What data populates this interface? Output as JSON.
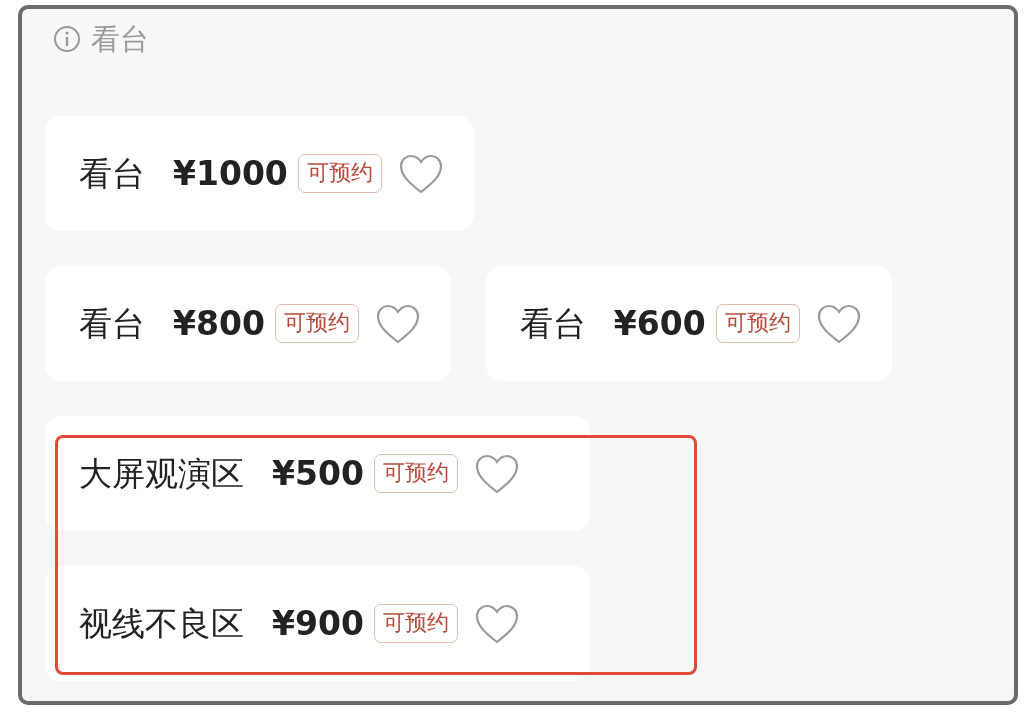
{
  "section": {
    "title": "看台"
  },
  "rows": [
    {
      "highlighted": false,
      "tickets": [
        {
          "name": "看台",
          "price": "¥1000",
          "tag": "可预约",
          "favorited": false
        }
      ]
    },
    {
      "highlighted": false,
      "tickets": [
        {
          "name": "看台",
          "price": "¥800",
          "tag": "可预约",
          "favorited": false
        },
        {
          "name": "看台",
          "price": "¥600",
          "tag": "可预约",
          "favorited": false
        }
      ]
    },
    {
      "highlighted": true,
      "tickets": [
        {
          "name": "大屏观演区",
          "price": "¥500",
          "tag": "可预约",
          "favorited": false
        }
      ]
    },
    {
      "highlighted": true,
      "tickets": [
        {
          "name": "视线不良区",
          "price": "¥900",
          "tag": "可预约",
          "favorited": false
        }
      ]
    }
  ]
}
